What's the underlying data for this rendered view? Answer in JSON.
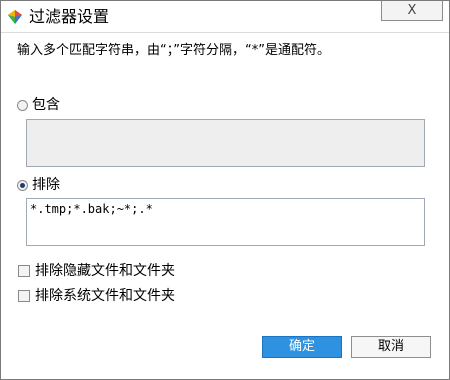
{
  "window": {
    "title": "过滤器设置",
    "close_label": "X"
  },
  "hint": "输入多个匹配字符串，由“；”字符分隔，“*”是通配符。",
  "include": {
    "label": "包含",
    "selected": false,
    "value": ""
  },
  "exclude": {
    "label": "排除",
    "selected": true,
    "value": "*.tmp;*.bak;~*;.*"
  },
  "options": {
    "hidden": {
      "label": "排除隐藏文件和文件夹",
      "checked": false
    },
    "system": {
      "label": "排除系统文件和文件夹",
      "checked": false
    }
  },
  "buttons": {
    "ok": "确定",
    "cancel": "取消"
  },
  "colors": {
    "accent": "#2f92e0",
    "radio_dot": "#1f3c6c"
  }
}
